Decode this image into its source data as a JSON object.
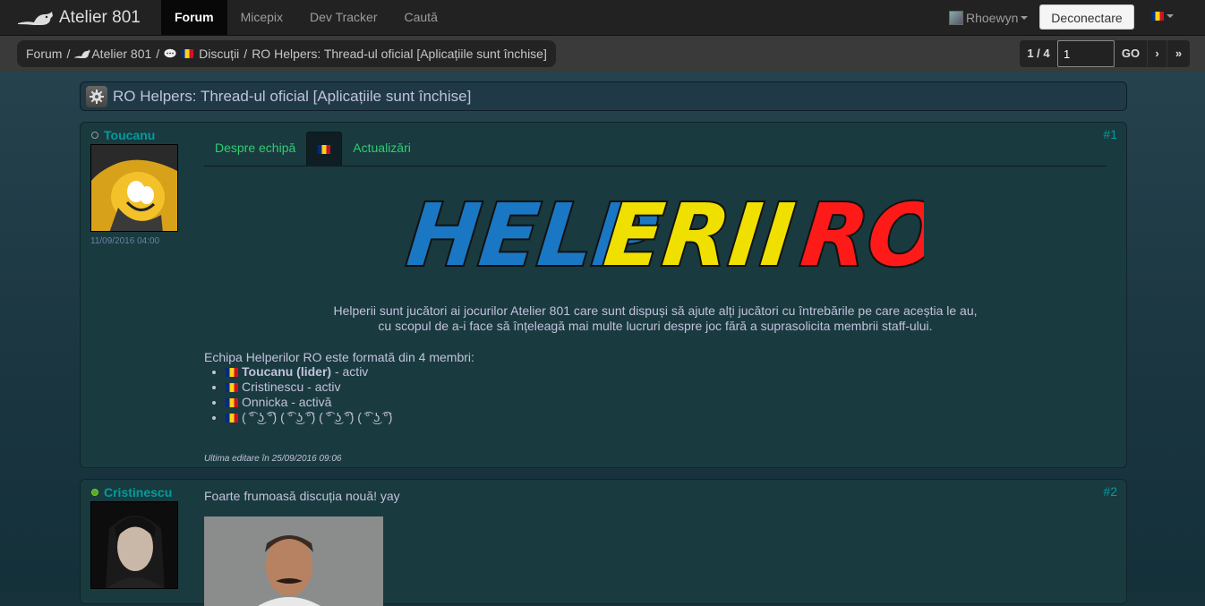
{
  "navbar": {
    "brand": "Atelier 801",
    "tabs": [
      "Forum",
      "Micepix",
      "Dev Tracker",
      "Caută"
    ],
    "active_tab": "Forum",
    "username": "Rhoewyn",
    "logout_label": "Deconectare"
  },
  "breadcrumb": {
    "forum": "Forum",
    "section": "Atelier 801",
    "category": "Discuții",
    "thread": "RO Helpers: Thread-ul oficial [Aplicațiile sunt închise]"
  },
  "pager": {
    "count": "1 / 4",
    "page_value": "1",
    "go": "GO",
    "next": "›",
    "last": "»"
  },
  "thread": {
    "title": "RO Helpers: Thread-ul oficial [Aplicațiile sunt închise]"
  },
  "post1": {
    "author": "Toucanu",
    "date": "11/09/2016 04:00",
    "number": "#1",
    "tabs": [
      "Despre echipă",
      "Actualizări"
    ],
    "logo_words": [
      "HELP",
      "ERII",
      "RO"
    ],
    "intro_line1": "Helperii sunt jucători ai jocurilor Atelier 801 care sunt dispuși să ajute alți jucători cu întrebările pe care aceștia le au,",
    "intro_line2": "cu scopul de a-i face să înțeleagă mai multe lucruri despre joc fără a suprasolicita membrii staff-ului.",
    "team_heading": "Echipa Helperilor RO este formată din 4 membri:",
    "members": [
      {
        "name": "Toucanu (lider)",
        "status": " - activ"
      },
      {
        "name": "Cristinescu",
        "status": " - activ"
      },
      {
        "name": "Onnicka",
        "status": " - activă"
      },
      {
        "name": "( ͡° ͜ʖ ͡°) ( ͡° ͜ʖ ͡°) ( ͡° ͜ʖ ͡°) ( ͡° ͜ʖ ͡°)",
        "status": ""
      }
    ],
    "edited": "Ultima editare în 25/09/2016 09:06"
  },
  "post2": {
    "author": "Cristinescu",
    "number": "#2",
    "text": "Foarte frumoasă discuția nouă! yay"
  },
  "colors": {
    "accent_teal": "#009d9d",
    "tab_green": "#2ecf71",
    "logo_blue": "#1a77c4",
    "logo_yellow": "#f0e000",
    "logo_red": "#ff1a1a"
  }
}
